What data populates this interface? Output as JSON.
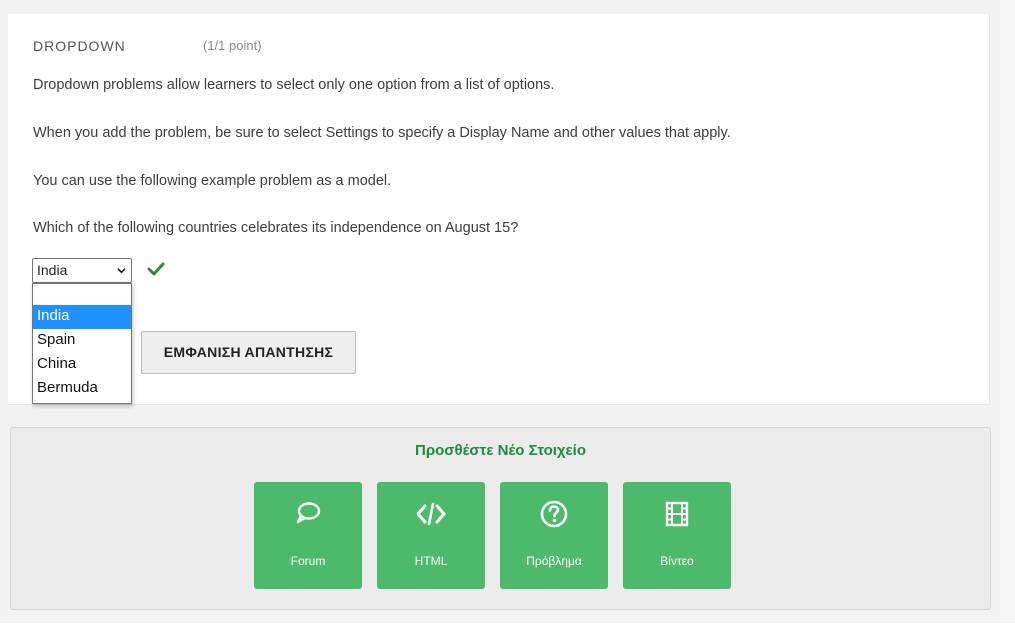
{
  "problem": {
    "title": "DROPDOWN",
    "points": "(1/1 point)",
    "paragraphs": [
      "Dropdown problems allow learners to select only one option from a list of options.",
      "When you add the problem, be sure to select Settings to specify a Display Name and other values that apply.",
      "You can use the following example problem as a model.",
      "Which of the following countries celebrates its independence on August 15?"
    ],
    "select": {
      "value": "India",
      "options": [
        "",
        "India",
        "Spain",
        "China",
        "Bermuda"
      ],
      "highlighted_option": "India"
    },
    "status_icon": "checkmark-icon",
    "show_answer_label": "ΕΜΦΑΝΙΣΗ ΑΠΑΝΤΗΣΗΣ"
  },
  "add_panel": {
    "title": "Προσθέστε Νέο Στοιχείο",
    "buttons": [
      {
        "label": "Forum",
        "icon": "speech-bubble-icon"
      },
      {
        "label": "HTML",
        "icon": "code-icon"
      },
      {
        "label": "Πρόβλημα",
        "icon": "question-circle-icon"
      },
      {
        "label": "Βίντεο",
        "icon": "film-icon"
      }
    ]
  },
  "colors": {
    "accent_green": "#4cba6a",
    "title_green": "#1e8c3a",
    "check_green": "#2e8b3d",
    "option_highlight": "#1e90ff"
  }
}
